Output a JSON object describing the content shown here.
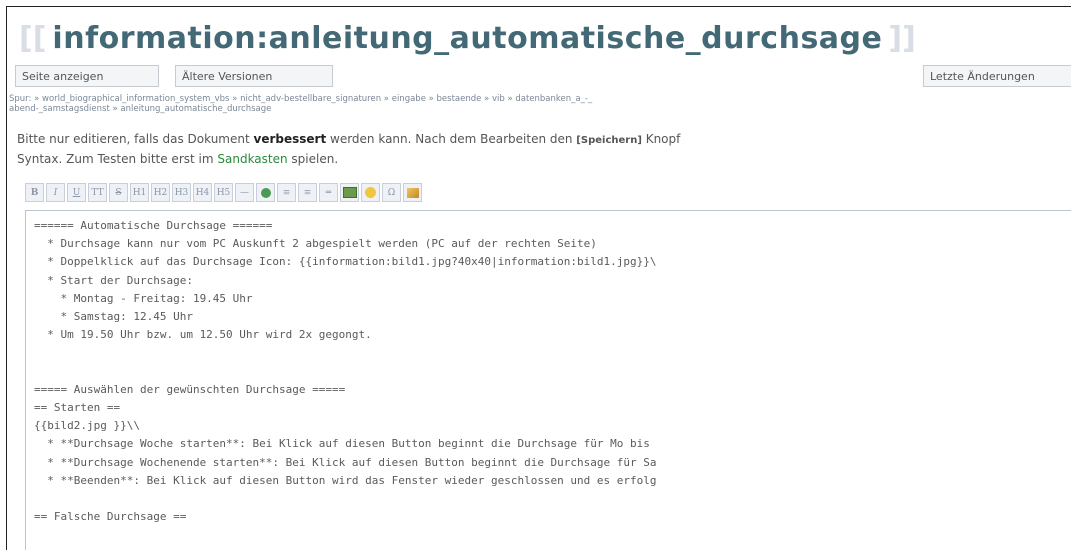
{
  "page": {
    "title": "information:anleitung_automatische_durchsage",
    "bracket_left": "[[",
    "bracket_right": "]]"
  },
  "buttons": {
    "show_page": "Seite anzeigen",
    "old_versions": "Ältere Versionen",
    "recent_changes": "Letzte Änderungen"
  },
  "breadcrumbs": {
    "line1": "Spur: » world_biographical_information_system_vbs » nicht_adv-bestellbare_signaturen » eingabe » bestaende » vib » datenbanken_a_-_",
    "line2": "abend-_samstagsdienst » anleitung_automatische_durchsage"
  },
  "info": {
    "part1": "Bitte nur editieren, falls das Dokument ",
    "bold": "verbessert",
    "part2": " werden kann. Nach dem Bearbeiten den ",
    "save": "[Speichern]",
    "part3": " Knopf",
    "line2_part1": "Syntax. Zum Testen bitte erst im ",
    "sandbox": "Sandkasten",
    "line2_part2": " spielen."
  },
  "toolbar": {
    "bold": "B",
    "italic": "I",
    "underline": "U",
    "code": "TT",
    "strike": "S",
    "h1": "H1",
    "h2": "H2",
    "h3": "H3",
    "h4": "H4",
    "h5": "H5",
    "hr": "—",
    "link": "",
    "ol": "≡",
    "ul": "≡",
    "line": "═",
    "image": "",
    "smiley": "",
    "special": "Ω",
    "signature": ""
  },
  "editor": {
    "lines": [
      "====== Automatische Durchsage ======",
      "  * Durchsage kann nur vom PC Auskunft 2 abgespielt werden (PC auf der rechten Seite)",
      "  * Doppelklick auf das Durchsage Icon: {{information:bild1.jpg?40x40|information:bild1.jpg}}\\",
      "  * Start der Durchsage:",
      "    * Montag - Freitag: 19.45 Uhr",
      "    * Samstag: 12.45 Uhr",
      "  * Um 19.50 Uhr bzw. um 12.50 Uhr wird 2x gegongt.",
      "",
      "",
      "===== Auswählen der gewünschten Durchsage =====",
      "== Starten ==",
      "{{bild2.jpg }}\\\\",
      "  * **Durchsage Woche starten**: Bei Klick auf diesen Button beginnt die Durchsage für Mo bis",
      "  * **Durchsage Wochenende starten**: Bei Klick auf diesen Button beginnt die Durchsage für Sa",
      "  * **Beenden**: Bei Klick auf diesen Button wird das Fenster wieder geschlossen und es erfolg",
      "",
      "== Falsche Durchsage =="
    ]
  }
}
